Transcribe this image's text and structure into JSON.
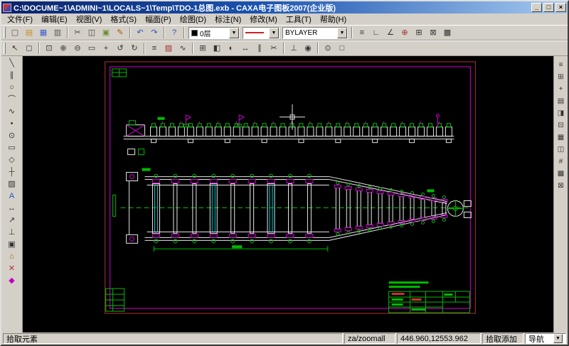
{
  "titlebar": {
    "title": "C:\\DOCUME~1\\ADMINI~1\\LOCALS~1\\Temp\\TDO-1总图.exb - CAXA电子图板2007(企业版)",
    "minimize": "_",
    "maximize": "□",
    "close": "×"
  },
  "menu": {
    "items": [
      "文件(F)",
      "编辑(E)",
      "视图(V)",
      "格式(S)",
      "幅面(P)",
      "绘图(D)",
      "标注(N)",
      "修改(M)",
      "工具(T)",
      "帮助(H)"
    ]
  },
  "toolbar1": {
    "icons": [
      {
        "name": "new-file",
        "glyph": "▢",
        "color": "#555555"
      },
      {
        "name": "open-folder",
        "glyph": "▤",
        "color": "#c09030"
      },
      {
        "name": "save-file",
        "glyph": "▦",
        "color": "#3a5fcd"
      },
      {
        "name": "print",
        "glyph": "▥",
        "color": "#555555"
      },
      {
        "sep": true
      },
      {
        "name": "cut",
        "glyph": "✂",
        "color": "#444444"
      },
      {
        "name": "copy",
        "glyph": "◫",
        "color": "#444444"
      },
      {
        "name": "paste",
        "glyph": "▣",
        "color": "#6a8f3a"
      },
      {
        "name": "format-brush",
        "glyph": "✎",
        "color": "#b05500"
      },
      {
        "sep": true
      },
      {
        "name": "undo",
        "glyph": "↶",
        "color": "#2a52be"
      },
      {
        "name": "redo",
        "glyph": "↷",
        "color": "#2a52be"
      },
      {
        "sep": true
      },
      {
        "name": "help",
        "glyph": "?",
        "color": "#2a52be"
      }
    ],
    "layer_combo": {
      "value": "0层"
    },
    "color_combo": {
      "color": "#cc2222"
    },
    "linetype_combo": {
      "value": "BYLAYER"
    },
    "right_icons": [
      {
        "name": "line-width-toggle",
        "glyph": "≡",
        "color": "#333333"
      },
      {
        "name": "ortho-mode",
        "glyph": "∟",
        "color": "#333333"
      },
      {
        "name": "polar-track",
        "glyph": "∠",
        "color": "#333333"
      },
      {
        "name": "object-snap",
        "glyph": "⊕",
        "color": "#a03333"
      },
      {
        "name": "grid-toggle",
        "glyph": "⊞",
        "color": "#333333"
      },
      {
        "name": "dynamic-input",
        "glyph": "⊠",
        "color": "#333333"
      },
      {
        "name": "render-mode",
        "glyph": "▩",
        "color": "#333333"
      }
    ]
  },
  "toolbar2": {
    "icons": [
      {
        "name": "select-arrow",
        "glyph": "↖",
        "color": "#333333"
      },
      {
        "name": "window-pick",
        "glyph": "◻",
        "color": "#333333"
      },
      {
        "sep": true
      },
      {
        "name": "zoom-window",
        "glyph": "⊡",
        "color": "#333333"
      },
      {
        "name": "zoom-in",
        "glyph": "⊕",
        "color": "#333333"
      },
      {
        "name": "zoom-out",
        "glyph": "⊖",
        "color": "#333333"
      },
      {
        "name": "zoom-all",
        "glyph": "▭",
        "color": "#333333"
      },
      {
        "name": "pan-view",
        "glyph": "+",
        "color": "#333333"
      },
      {
        "name": "previous-view",
        "glyph": "↺",
        "color": "#333333"
      },
      {
        "name": "redraw-view",
        "glyph": "↻",
        "color": "#333333"
      },
      {
        "sep": true
      },
      {
        "name": "layer-manager",
        "glyph": "≡",
        "color": "#333333"
      },
      {
        "name": "color-picker",
        "glyph": "▨",
        "color": "#a03333"
      },
      {
        "name": "linetype-manager",
        "glyph": "∿",
        "color": "#333333"
      },
      {
        "sep": true
      },
      {
        "name": "array-tool",
        "glyph": "⊞",
        "color": "#333333"
      },
      {
        "name": "mirror-tool",
        "glyph": "◧",
        "color": "#333333"
      },
      {
        "name": "rotate-tool",
        "glyph": "◐",
        "color": "#333333"
      },
      {
        "name": "move-tool",
        "glyph": "↔",
        "color": "#333333"
      },
      {
        "name": "offset-tool",
        "glyph": "∥",
        "color": "#333333"
      },
      {
        "name": "trim-tool",
        "glyph": "✂",
        "color": "#333333"
      },
      {
        "sep": true
      },
      {
        "name": "measure-tool",
        "glyph": "⊥",
        "color": "#333333"
      },
      {
        "name": "query-tool",
        "glyph": "◉",
        "color": "#333333"
      },
      {
        "sep": true
      },
      {
        "name": "zoom-dynamic",
        "glyph": "⊙",
        "color": "#333333"
      },
      {
        "name": "full-screen",
        "glyph": "□",
        "color": "#333333"
      }
    ]
  },
  "left_toolbar": {
    "icons": [
      {
        "name": "line-tool",
        "glyph": "╲",
        "color": "#333333"
      },
      {
        "name": "parallel-line-tool",
        "glyph": "∥",
        "color": "#333333"
      },
      {
        "name": "circle-tool",
        "glyph": "○",
        "color": "#333333"
      },
      {
        "name": "arc-tool",
        "glyph": "⌒",
        "color": "#333333"
      },
      {
        "name": "spline-tool",
        "glyph": "∿",
        "color": "#333333"
      },
      {
        "name": "point-tool",
        "glyph": "•",
        "color": "#333333"
      },
      {
        "name": "ellipse-tool",
        "glyph": "⊙",
        "color": "#333333"
      },
      {
        "name": "rectangle-tool",
        "glyph": "▭",
        "color": "#333333"
      },
      {
        "name": "polygon-tool",
        "glyph": "◇",
        "color": "#333333"
      },
      {
        "name": "centerline-tool",
        "glyph": "┼",
        "color": "#333333"
      },
      {
        "name": "hatch-tool",
        "glyph": "▨",
        "color": "#333333"
      },
      {
        "name": "text-tool",
        "glyph": "A",
        "color": "#2a52be"
      },
      {
        "name": "dimension-tool",
        "glyph": "↔",
        "color": "#333333"
      },
      {
        "name": "leader-tool",
        "glyph": "↗",
        "color": "#333333"
      },
      {
        "name": "datum-tool",
        "glyph": "⊥",
        "color": "#333333"
      },
      {
        "name": "block-tool",
        "glyph": "▣",
        "color": "#333333"
      },
      {
        "name": "library-tool",
        "glyph": "⌂",
        "color": "#8a6a00"
      },
      {
        "name": "erase-tool",
        "glyph": "✕",
        "color": "#b03333"
      },
      {
        "name": "modify-tool",
        "glyph": "◆",
        "color": "#c000c0"
      }
    ]
  },
  "right_toolbar": {
    "icons": [
      {
        "name": "properties-panel",
        "glyph": "≡",
        "color": "#333333"
      },
      {
        "name": "view-manager",
        "glyph": "⊞",
        "color": "#333333"
      },
      {
        "name": "coordinate-panel",
        "glyph": "+",
        "color": "#333333"
      },
      {
        "name": "layers-panel",
        "glyph": "▤",
        "color": "#333333"
      },
      {
        "name": "split-view",
        "glyph": "◨",
        "color": "#333333"
      },
      {
        "name": "collapse-panel",
        "glyph": "⊟",
        "color": "#333333"
      },
      {
        "name": "grid-panel",
        "glyph": "▦",
        "color": "#333333"
      },
      {
        "name": "columns-panel",
        "glyph": "◫",
        "color": "#333333"
      },
      {
        "name": "snap-panel",
        "glyph": "#",
        "color": "#333333"
      },
      {
        "name": "pattern-panel",
        "glyph": "▩",
        "color": "#333333"
      },
      {
        "name": "close-panel",
        "glyph": "⊠",
        "color": "#333333"
      }
    ]
  },
  "statusbar": {
    "prompt": "拾取元素",
    "command": "za/zoomall",
    "coordinates": "446.960,12553.962",
    "pick_mode": "拾取添加",
    "nav_label": "导航",
    "nav_arrow": "▼"
  },
  "drawing": {
    "colors": {
      "white": "#e6e6e6",
      "green": "#00bb00",
      "magenta": "#d400d4",
      "red": "#b03030",
      "cyan": "#00c8c8",
      "titleblock_red": "#cc3333"
    },
    "top_roller_count": 33,
    "main_roller_count": 9,
    "taper_roller_count": 11
  }
}
